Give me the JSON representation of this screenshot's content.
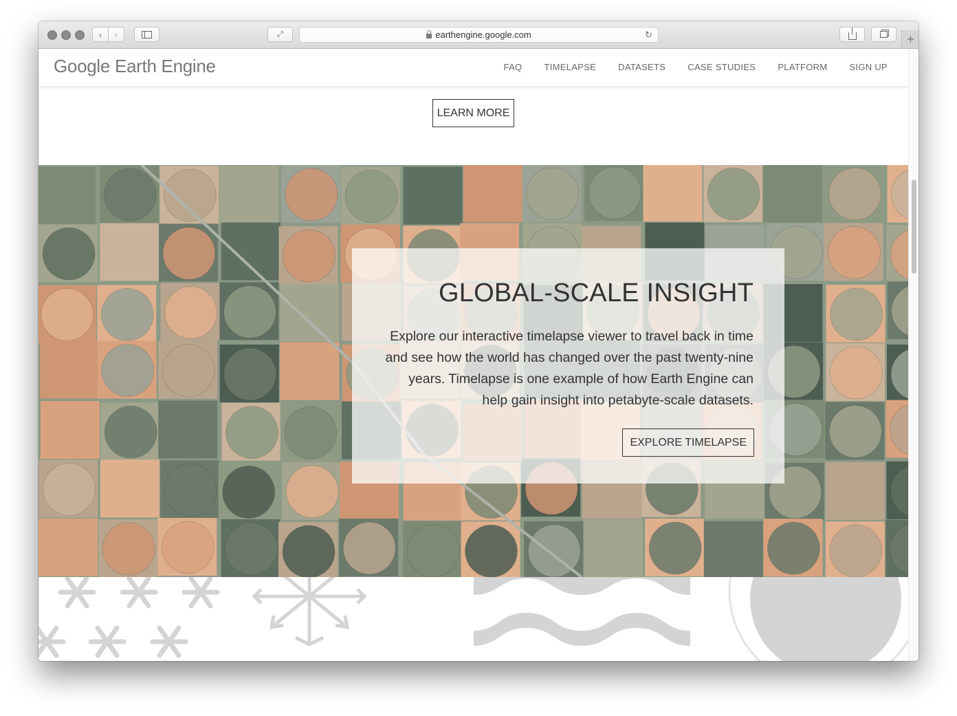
{
  "browser": {
    "url": "earthengine.google.com",
    "buttons": {
      "back": "‹",
      "forward": "›",
      "reload": "↻",
      "new_tab": "+"
    }
  },
  "header": {
    "logo": "Google Earth Engine",
    "nav": [
      "FAQ",
      "TIMELAPSE",
      "DATASETS",
      "CASE STUDIES",
      "PLATFORM",
      "SIGN UP"
    ]
  },
  "learn_more_label": "LEARN MORE",
  "hero": {
    "title": "GLOBAL-SCALE INSIGHT",
    "body": "Explore our interactive timelapse viewer to travel back in time and see how the world has changed over the past twenty-nine years. Timelapse is one example of how Earth Engine can help gain insight into petabyte-scale datasets.",
    "button": "EXPLORE TIMELAPSE"
  },
  "colors": {
    "text": "#333333",
    "nav_text": "#666666",
    "decor_gray": "#d4d4d4"
  }
}
